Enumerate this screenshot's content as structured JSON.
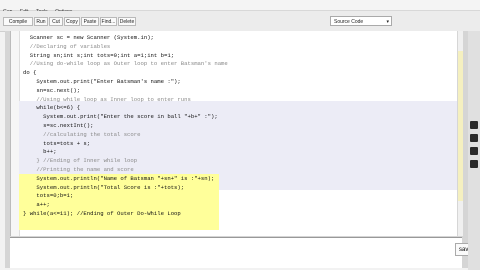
{
  "menu": [
    "Gen",
    "Edit",
    "Tools",
    "Options"
  ],
  "toolbar": {
    "buttons": [
      "Compile",
      "Run",
      "Cut",
      "Copy",
      "Paste",
      "Find...",
      "Delete"
    ],
    "select_value": "Source Code"
  },
  "editor": {
    "lines": [
      {
        "text": "  Scanner sc = new Scanner (System.in);",
        "type": "code"
      },
      {
        "text": "  //Declaring of variables",
        "type": "comment"
      },
      {
        "text": "  String sn;int s;int tots=0;int a=1;int b=1;",
        "type": "code"
      },
      {
        "text": "  //Using do-while loop as Outer loop to enter Batsman's name",
        "type": "comment"
      },
      {
        "text": "do {",
        "type": "code"
      },
      {
        "text": "    System.out.print(\"Enter Batsman's name :\");",
        "type": "code"
      },
      {
        "text": "    sn=sc.next();",
        "type": "code"
      },
      {
        "text": "    //Using while loop as Inner loop to enter runs",
        "type": "comment"
      },
      {
        "text": "    while(b<=6) {",
        "type": "code"
      },
      {
        "text": "      System.out.print(\"Enter the score in ball \"+b+\" :\");",
        "type": "code"
      },
      {
        "text": "      s=sc.nextInt();",
        "type": "code"
      },
      {
        "text": "      //calculating the total score",
        "type": "comment"
      },
      {
        "text": "      tots=tots + s;",
        "type": "code"
      },
      {
        "text": "      b++;",
        "type": "code"
      },
      {
        "text": "    } //Ending of Inner while loop",
        "type": "comment"
      },
      {
        "text": "    //Printing the name and score",
        "type": "comment"
      },
      {
        "text": "    System.out.println(\"Name of Batsman \"+sn+\" is :\"+sn);",
        "type": "code"
      },
      {
        "text": "    System.out.println(\"Total Score is :\"+tots);",
        "type": "code"
      },
      {
        "text": "    tots=0;b=1;",
        "type": "code"
      },
      {
        "text": "    a++;",
        "type": "code"
      },
      {
        "text": "} while(a<=11); //Ending of Outer Do-While Loop",
        "type": "code"
      }
    ]
  },
  "save_label": "saved",
  "colors": {
    "highlight_block": "#ffff9a",
    "highlight_loop": "#ececf6",
    "scroll_thumb": "#f5f0c0"
  }
}
